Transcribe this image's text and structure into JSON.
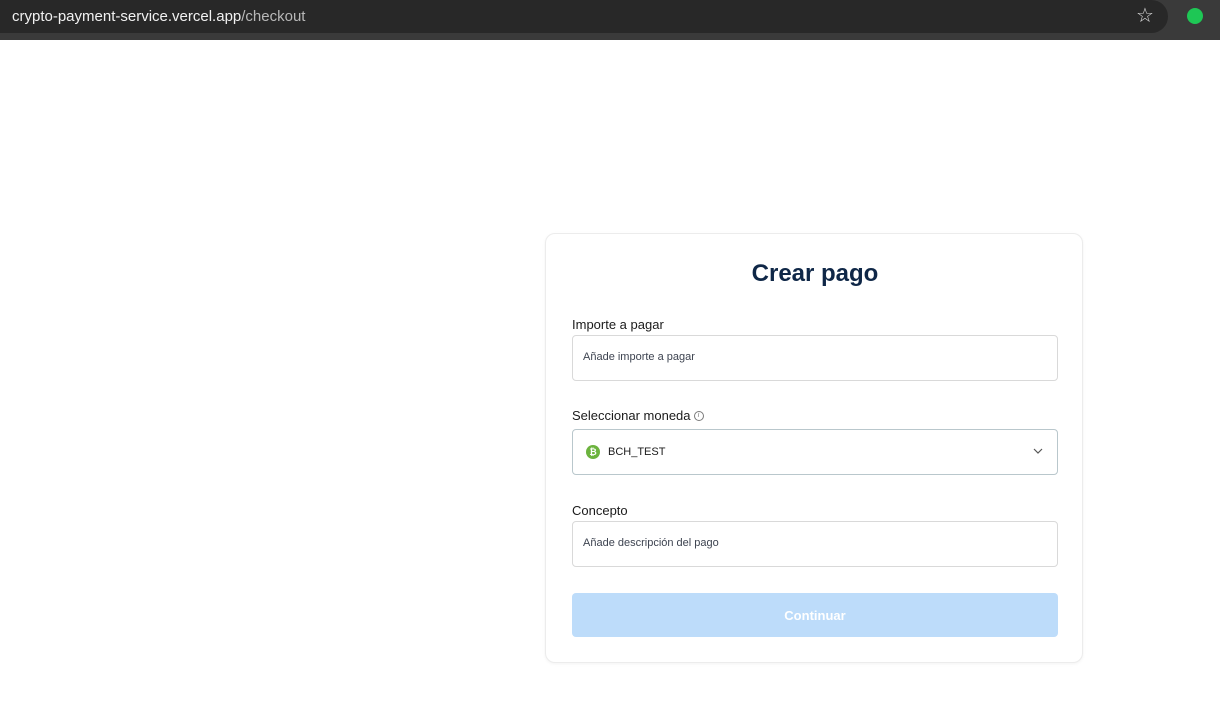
{
  "browser": {
    "url_host": "crypto-payment-service.vercel.app",
    "url_path": "/checkout",
    "bookmark_icon": "star-icon",
    "extension_color": "#1ec755"
  },
  "form": {
    "title": "Crear pago",
    "amount": {
      "label": "Importe a pagar",
      "placeholder": "Añade importe a pagar",
      "value": ""
    },
    "currency": {
      "label": "Seleccionar moneda",
      "info_icon": "info-icon",
      "selected": "BCH_TEST",
      "coin_icon": "bitcoin-cash-icon",
      "coin_color": "#6cb33e"
    },
    "concept": {
      "label": "Concepto",
      "placeholder": "Añade descripción del pago",
      "value": ""
    },
    "submit_label": "Continuar",
    "accent_title_color": "#0f2747",
    "button_color": "#bddcfa"
  }
}
